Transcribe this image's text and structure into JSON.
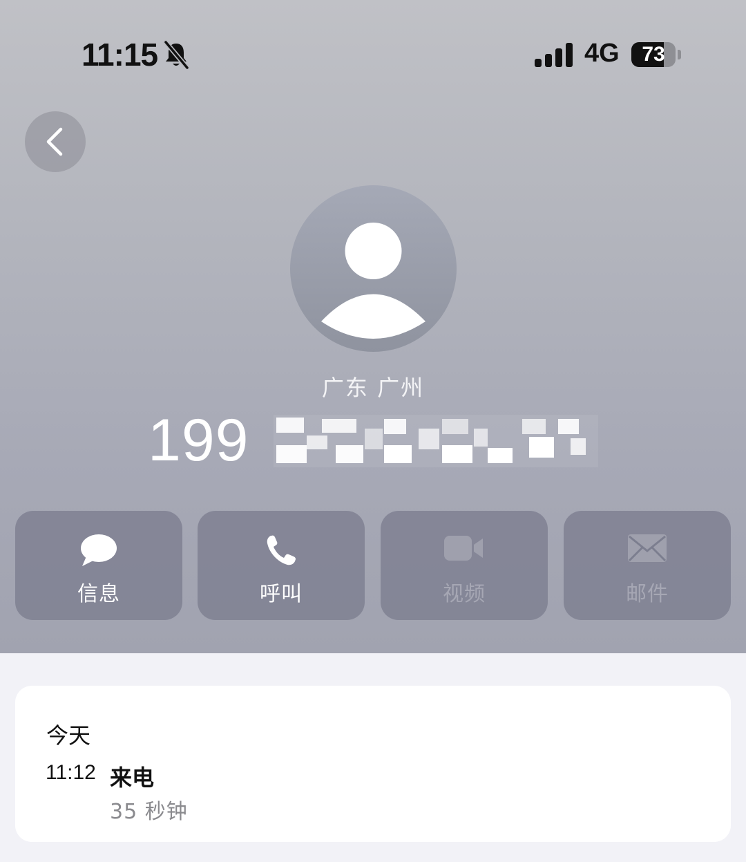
{
  "status_bar": {
    "time": "11:15",
    "network": "4G",
    "battery_level": "73",
    "battery_fraction": 0.73,
    "icons": [
      "bell-muted-icon",
      "signal-icon",
      "battery-icon"
    ]
  },
  "contact": {
    "location": "广东 广州",
    "phone_visible": "199",
    "phone_redacted": true
  },
  "actions": [
    {
      "label": "信息",
      "icon": "message-icon",
      "enabled": true
    },
    {
      "label": "呼叫",
      "icon": "phone-icon",
      "enabled": true
    },
    {
      "label": "视频",
      "icon": "video-icon",
      "enabled": false
    },
    {
      "label": "邮件",
      "icon": "mail-icon",
      "enabled": false
    }
  ],
  "call_history": {
    "date": "今天",
    "entries": [
      {
        "time": "11:12",
        "type": "来电",
        "duration": "35 秒钟"
      }
    ]
  },
  "colors": {
    "header_top": "#c0c1c6",
    "header_bottom": "#a1a3b0",
    "action_bg": "#787a8c",
    "background": "#f2f2f7",
    "muted_text": "#8a8a8e"
  }
}
